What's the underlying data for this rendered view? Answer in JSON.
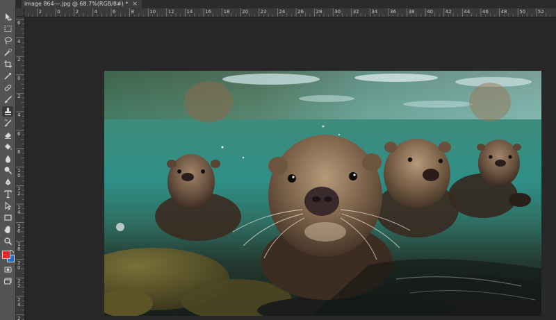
{
  "document_tab": {
    "title": "image 864---.jpg @ 68.7%(RGB/8#) *",
    "close_symbol": "×"
  },
  "ruler_top_labels": [
    "4",
    "2",
    "0",
    "2",
    "4",
    "6",
    "8",
    "10",
    "12",
    "14",
    "16",
    "18",
    "20",
    "22",
    "24",
    "26",
    "28",
    "30",
    "32",
    "34",
    "36",
    "38",
    "40",
    "42",
    "44",
    "46",
    "48",
    "50",
    "52"
  ],
  "ruler_left_labels": [
    "6",
    "4",
    "2",
    "0",
    "2",
    "4",
    "6",
    "8",
    "1\n0",
    "1\n2",
    "1\n4",
    "1\n6",
    "1\n8",
    "2\n0",
    "2\n2",
    "2\n4",
    "2\n6"
  ],
  "tools": [
    "move-tool-icon",
    "marquee-tool-icon",
    "lasso-tool-icon",
    "quick-select-tool-icon",
    "crop-tool-icon",
    "eyedropper-tool-icon",
    "healing-brush-tool-icon",
    "brush-tool-icon",
    "clone-stamp-tool-icon",
    "history-brush-tool-icon",
    "eraser-tool-icon",
    "paint-bucket-tool-icon",
    "blur-tool-icon",
    "dodge-tool-icon",
    "pen-tool-icon",
    "type-tool-icon",
    "path-select-tool-icon",
    "rectangle-tool-icon",
    "hand-tool-icon",
    "zoom-tool-icon"
  ],
  "colors": {
    "foreground": "#e8262a",
    "background": "#1e6fd9",
    "toolbar": "#535353",
    "workspace": "#282828"
  }
}
